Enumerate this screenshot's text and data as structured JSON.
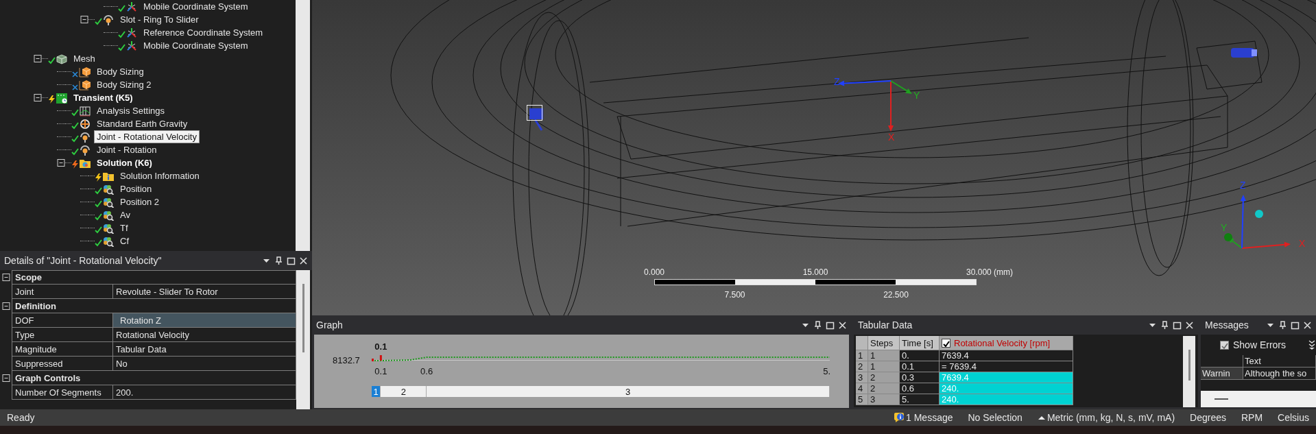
{
  "tree": [
    {
      "children": [
        {
          "children": [
            {
              "children": [
                {
                  "children": [
                    {
                      "label": "Mobile Coordinate System",
                      "kind": "coordinate-system",
                      "status": {
                        "kind": "check"
                      },
                      "selected": false
                    }
                  ]
                },
                {
                  "label": "Slot - Ring To Slider",
                  "kind": "joint",
                  "status": {
                    "kind": "check"
                  },
                  "selected": false,
                  "expanded": true,
                  "children": [
                    {
                      "label": "Reference Coordinate System",
                      "kind": "coordinate-system",
                      "status": {
                        "kind": "check"
                      },
                      "selected": false
                    },
                    {
                      "label": "Mobile Coordinate System",
                      "kind": "coordinate-system",
                      "status": {
                        "kind": "check"
                      },
                      "selected": false
                    }
                  ]
                }
              ]
            }
          ]
        },
        {
          "label": "Mesh",
          "kind": "mesh",
          "status": {
            "kind": "check"
          },
          "selected": false,
          "expanded": true,
          "children": [
            {
              "label": "Body Sizing",
              "kind": "body-sizing",
              "status": {
                "kind": "x"
              },
              "selected": false
            },
            {
              "label": "Body Sizing 2",
              "kind": "body-sizing",
              "status": {
                "kind": "x"
              },
              "selected": false
            }
          ]
        },
        {
          "label": "Transient (K5)",
          "kind": "transient",
          "status": {
            "kind": "bolt"
          },
          "selected": false,
          "expanded": true,
          "children": [
            {
              "label": "Analysis Settings",
              "kind": "analysis-settings",
              "status": {
                "kind": "check"
              },
              "selected": false
            },
            {
              "label": "Standard Earth Gravity",
              "kind": "gravity",
              "status": {
                "kind": "check"
              },
              "selected": false
            },
            {
              "label": "Joint - Rotational Velocity",
              "kind": "joint",
              "status": {
                "kind": "check"
              },
              "selected": true
            },
            {
              "label": "Joint - Rotation",
              "kind": "joint",
              "status": {
                "kind": "check"
              },
              "selected": false
            },
            {
              "label": "Solution (K6)",
              "kind": "solution",
              "status": {
                "kind": "bolt-red"
              },
              "selected": false,
              "expanded": true,
              "children": [
                {
                  "label": "Solution Information",
                  "kind": "solution-info",
                  "status": {
                    "kind": "bolt"
                  },
                  "selected": false
                },
                {
                  "label": "Position",
                  "kind": "result",
                  "status": {
                    "kind": "check"
                  },
                  "selected": false
                },
                {
                  "label": "Position 2",
                  "kind": "result",
                  "status": {
                    "kind": "check"
                  },
                  "selected": false
                },
                {
                  "label": "Av",
                  "kind": "result",
                  "status": {
                    "kind": "check"
                  },
                  "selected": false
                },
                {
                  "label": "Tf",
                  "kind": "result",
                  "status": {
                    "kind": "check"
                  },
                  "selected": false
                },
                {
                  "label": "Cf",
                  "kind": "result",
                  "status": {
                    "kind": "check"
                  },
                  "selected": false
                }
              ]
            }
          ]
        }
      ]
    }
  ],
  "details": {
    "title": "Details of \"Joint - Rotational Velocity\"",
    "sections": [
      {
        "label": "Scope",
        "expanded": true,
        "rows": [
          {
            "label": "Joint",
            "value": "Revolute - Slider To Rotor",
            "selected": false
          }
        ]
      },
      {
        "label": "Definition",
        "expanded": true,
        "rows": [
          {
            "label": "DOF",
            "value": "Rotation Z",
            "selected": true
          },
          {
            "label": "Type",
            "value": "Rotational Velocity",
            "selected": false
          },
          {
            "label": "Magnitude",
            "value": "Tabular Data",
            "selected": false
          },
          {
            "label": "Suppressed",
            "value": "No",
            "selected": false
          }
        ]
      },
      {
        "label": "Graph Controls",
        "expanded": true,
        "rows": [
          {
            "label": "Number Of Segments",
            "value": "200.",
            "selected": false
          }
        ]
      }
    ]
  },
  "viewport": {
    "scale_bar": {
      "top_labels": [
        "0.000",
        "15.000",
        "30.000 (mm)"
      ],
      "bottom_labels": [
        "7.500",
        "22.500"
      ]
    },
    "center_triad": {
      "x": "X",
      "y": "Y",
      "z": "Z"
    },
    "corner_triad": {
      "x": "X",
      "y": "Y",
      "z": "Z"
    }
  },
  "graph": {
    "title": "Graph",
    "y_value": "8132.7",
    "marker": "0.1",
    "x_ticks": [
      "0.1",
      "0.6",
      "5."
    ],
    "steps": [
      {
        "label": "1",
        "selected": true
      },
      {
        "label": "2",
        "selected": false
      },
      {
        "label": "3",
        "selected": false
      }
    ]
  },
  "tabular": {
    "title": "Tabular Data",
    "columns": [
      "Steps",
      "Time [s]",
      "Rotational Velocity [rpm]"
    ],
    "value_column_checked": true,
    "rows": [
      {
        "index": "1",
        "step": "1",
        "time": "0.",
        "value": "7639.4",
        "selected": false
      },
      {
        "index": "2",
        "step": "1",
        "time": "0.1",
        "value": "= 7639.4",
        "selected": false
      },
      {
        "index": "3",
        "step": "2",
        "time": "0.3",
        "value": "7639.4",
        "selected": true
      },
      {
        "index": "4",
        "step": "2",
        "time": "0.6",
        "value": "240.",
        "selected": true
      },
      {
        "index": "5",
        "step": "3",
        "time": "5.",
        "value": "240.",
        "selected": true
      }
    ]
  },
  "messages": {
    "title": "Messages",
    "show_errors": {
      "label": "Show Errors",
      "checked": true
    },
    "column": "Text",
    "rows": [
      {
        "type": "Warnin",
        "text": "Although the so"
      }
    ]
  },
  "status_bar": {
    "state": "Ready",
    "messages": "1 Message",
    "selection": "No Selection",
    "units": "Metric (mm, kg, N, s, mV, mA)",
    "angle": "Degrees",
    "speed": "RPM",
    "temperature": "Celsius"
  }
}
